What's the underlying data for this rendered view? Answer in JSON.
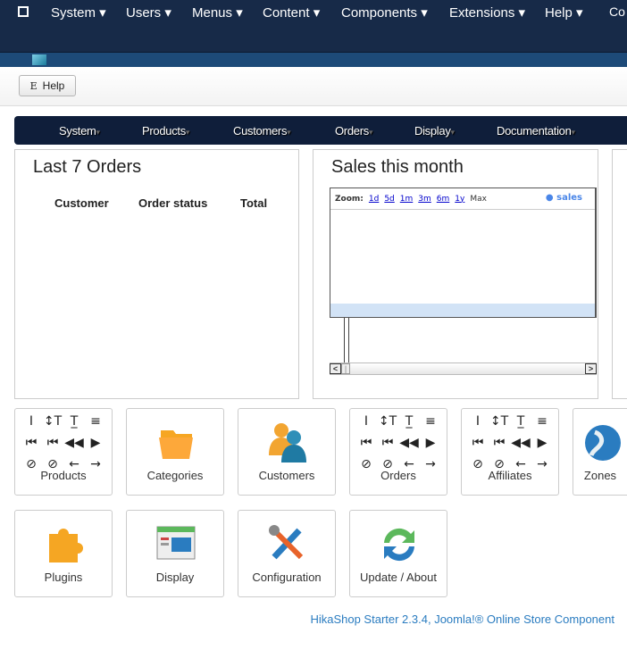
{
  "topnav": {
    "items": [
      "System",
      "Users",
      "Menus",
      "Content",
      "Components",
      "Extensions",
      "Help",
      "Co"
    ]
  },
  "toolbar": {
    "help_label": "Help",
    "help_glyph": "E"
  },
  "subnav": {
    "items": [
      "System",
      "Products",
      "Customers",
      "Orders",
      "Display",
      "Documentation"
    ]
  },
  "orders_panel": {
    "title": "Last 7 Orders",
    "columns": [
      "Customer",
      "Order status",
      "Total"
    ]
  },
  "sales_panel": {
    "title": "Sales this month",
    "zoom_label": "Zoom:",
    "zoom_options": [
      "1d",
      "5d",
      "1m",
      "3m",
      "6m",
      "1y",
      "Max"
    ],
    "legend": "sales"
  },
  "tiles": [
    {
      "label": "Products",
      "icon": "missing-icon-glyphs"
    },
    {
      "label": "Categories",
      "icon": "folder-icon"
    },
    {
      "label": "Customers",
      "icon": "users-icon"
    },
    {
      "label": "Orders",
      "icon": "missing-icon-glyphs"
    },
    {
      "label": "Affiliates",
      "icon": "missing-icon-glyphs"
    },
    {
      "label": "Zones",
      "icon": "globe-icon"
    },
    {
      "label": "Plugins",
      "icon": "puzzle-icon"
    },
    {
      "label": "Display",
      "icon": "window-icon"
    },
    {
      "label": "Configuration",
      "icon": "tools-icon"
    },
    {
      "label": "Update / About",
      "icon": "refresh-icon"
    }
  ],
  "glyph_set": [
    "I",
    "↕T",
    "T̲",
    "≡",
    "⏮",
    "⏮",
    "◀◀",
    "▶",
    "⊘",
    "⊘",
    "←",
    "→"
  ],
  "footer": "HikaShop Starter 2.3.4, Joomla!® Online Store Component"
}
